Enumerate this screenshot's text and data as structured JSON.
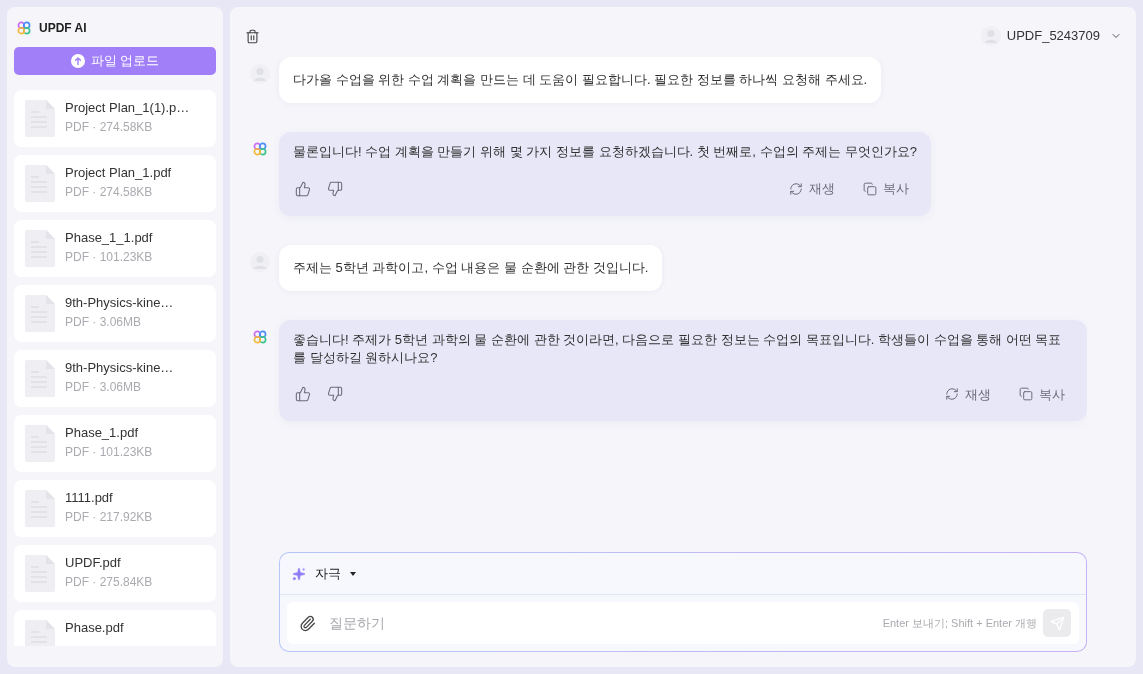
{
  "sidebar": {
    "app_name": "UPDF AI",
    "upload_button": "파일 업로드",
    "files": [
      {
        "name": "Project Plan_1(1).p…",
        "info": "PDF · 274.58KB"
      },
      {
        "name": "Project Plan_1.pdf",
        "info": "PDF · 274.58KB"
      },
      {
        "name": "Phase_1_1.pdf",
        "info": "PDF · 101.23KB"
      },
      {
        "name": "9th-Physics-kine…",
        "info": "PDF · 3.06MB"
      },
      {
        "name": "9th-Physics-kine…",
        "info": "PDF · 3.06MB"
      },
      {
        "name": "Phase_1.pdf",
        "info": "PDF · 101.23KB"
      },
      {
        "name": "1111.pdf",
        "info": "PDF · 217.92KB"
      },
      {
        "name": "UPDF.pdf",
        "info": "PDF · 275.84KB"
      },
      {
        "name": "Phase.pdf"
      }
    ]
  },
  "header": {
    "username": "UPDF_5243709"
  },
  "messages": [
    {
      "kind": "user",
      "text": "다가올 수업을 위한 수업 계획을 만드는 데 도움이 필요합니다. 필요한 정보를 하나씩 요청해 주세요."
    },
    {
      "kind": "assistant",
      "text": "물론입니다! 수업 계획을 만들기 위해 몇 가지 정보를 요청하겠습니다. 첫 번째로, 수업의 주제는 무엇인가요?",
      "actions": [
        {
          "kind": "regenerate",
          "label": "재생"
        },
        {
          "kind": "copy",
          "label": "복사"
        }
      ]
    },
    {
      "kind": "user",
      "text": "주제는 5학년 과학이고, 수업 내용은 물 순환에 관한 것입니다."
    },
    {
      "kind": "assistant",
      "text": "좋습니다! 주제가 5학년 과학의 물 순환에 관한 것이라면, 다음으로 필요한 정보는 수업의 목표입니다. 학생들이 수업을 통해 어떤 목표를 달성하길 원하시나요?",
      "actions": [
        {
          "kind": "regenerate",
          "label": "재생"
        },
        {
          "kind": "copy",
          "label": "복사"
        }
      ]
    }
  ],
  "composer": {
    "mode": "자극",
    "placeholder": "질문하기",
    "hint": "Enter 보내기; Shift + Enter 개행"
  }
}
